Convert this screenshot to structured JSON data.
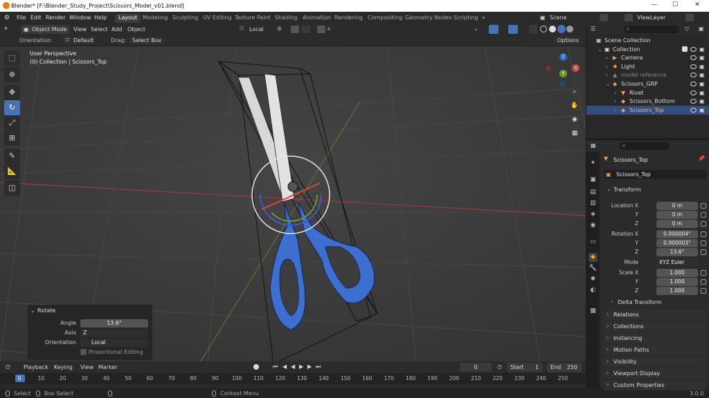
{
  "window": {
    "title": "Blender* [F:\\Blender_Study_Project\\Scissors_Model_v01.blend]"
  },
  "menus": [
    "File",
    "Edit",
    "Render",
    "Window",
    "Help"
  ],
  "workspaces": [
    "Layout",
    "Modeling",
    "Sculpting",
    "UV Editing",
    "Texture Paint",
    "Shading",
    "Animation",
    "Rendering",
    "Compositing",
    "Geometry Nodes",
    "Scripting",
    "+"
  ],
  "scene": {
    "label": "Scene",
    "view_layer": "ViewLayer"
  },
  "viewport_header": {
    "mode": "Object Mode",
    "menus": [
      "View",
      "Select",
      "Add",
      "Object"
    ],
    "transform_orientation": "Local"
  },
  "tool_settings": {
    "orientation_label": "Orientation:",
    "orientation_value": "Default",
    "drag_label": "Drag:",
    "drag_value": "Select Box",
    "options": "Options"
  },
  "viewport": {
    "view_name": "User Perspective",
    "collection_info": "(0) Collection | Scissors_Top"
  },
  "gizmo_axes": {
    "x": "X",
    "y": "Y",
    "z": "Z"
  },
  "operator_panel": {
    "title": "Rotate",
    "angle_label": "Angle",
    "angle_value": "13.6°",
    "axis_label": "Axis",
    "axis_value": "Z",
    "orientation_label": "Orientation",
    "orientation_value": "Local",
    "proportional_label": "Proportional Editing"
  },
  "timeline": {
    "menus": [
      "Playback",
      "Keying",
      "View",
      "Marker"
    ],
    "current_frame": "0",
    "start_label": "Start",
    "start_value": "1",
    "end_label": "End",
    "end_value": "250",
    "ticks": [
      "0",
      "10",
      "20",
      "30",
      "40",
      "50",
      "60",
      "70",
      "80",
      "90",
      "100",
      "110",
      "120",
      "130",
      "140",
      "150",
      "160",
      "170",
      "180",
      "190",
      "200",
      "210",
      "220",
      "230",
      "240",
      "250"
    ]
  },
  "statusbar": {
    "select": "Select",
    "box_select": "Box Select",
    "context_menu": "Context Menu",
    "version": "3.0.0"
  },
  "outliner": {
    "rows": [
      {
        "label": "Scene Collection",
        "indent": 0
      },
      {
        "label": "Collection",
        "indent": 1
      },
      {
        "label": "Camera",
        "indent": 2
      },
      {
        "label": "Light",
        "indent": 2
      },
      {
        "label": "model reference",
        "indent": 2
      },
      {
        "label": "Scissors_GRP",
        "indent": 2
      },
      {
        "label": "Rivet",
        "indent": 3
      },
      {
        "label": "Scissors_Bottom",
        "indent": 3
      },
      {
        "label": "Scissors_Top",
        "indent": 3
      }
    ]
  },
  "properties": {
    "object_name": "Scissors_Top",
    "object_field": "Scissors_Top",
    "transform_title": "Transform",
    "location_label": "Location X",
    "location": [
      "0 m",
      "0 m",
      "0 m"
    ],
    "rotation_label": "Rotation X",
    "rotation": [
      "0.000004°",
      "0.000003°",
      "13.6°"
    ],
    "mode_label": "Mode",
    "mode_value": "XYZ Euler",
    "scale_label": "Scale X",
    "scale": [
      "1.000",
      "1.000",
      "1.000"
    ],
    "axis_y": "Y",
    "axis_z": "Z",
    "delta_transform": "Delta Transform",
    "panels": [
      "Relations",
      "Collections",
      "Instancing",
      "Motion Paths",
      "Visibility",
      "Viewport Display",
      "Custom Properties"
    ]
  },
  "colors": {
    "accent": "#4772b3",
    "selected_row": "#334d80",
    "scissor_handle": "#3c6fd0",
    "x_axis": "#c84a4a",
    "y_axis": "#7a9a2a"
  }
}
